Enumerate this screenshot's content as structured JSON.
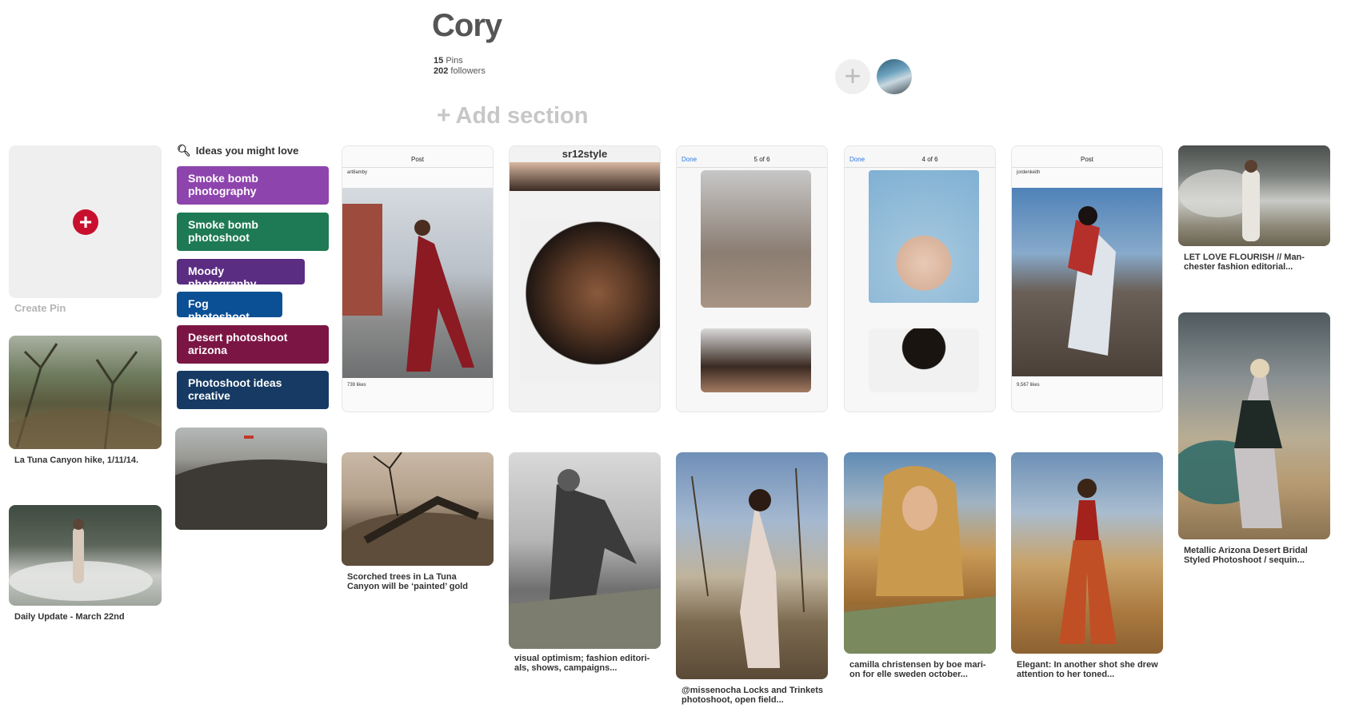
{
  "board": {
    "title": "Cory",
    "pins_count": "15",
    "pins_label": "Pins",
    "followers_count": "202",
    "followers_label": "followers",
    "add_icon": "plus-icon",
    "add_section_label": "Add section"
  },
  "create_pin": {
    "label": "Create Pin"
  },
  "ideas": {
    "header": "Ideas you might love",
    "items": [
      {
        "label": "Smoke bomb photography",
        "color": "#8e44ad"
      },
      {
        "label": "Smoke bomb photoshoot",
        "color": "#1e7a54"
      },
      {
        "label": "Moody photography",
        "color": "#5a2d82"
      },
      {
        "label": "Fog photoshoot",
        "color": "#0b4f94"
      },
      {
        "label": "Desert photoshoot arizona",
        "color": "#7b1544"
      },
      {
        "label": "Photoshoot ideas creative",
        "color": "#163a63"
      }
    ]
  },
  "pins": {
    "la_tuna": "La Tuna Canyon hike, 1/11/14.",
    "daily_update": "Daily Update - March 22nd",
    "scorched": "Scorched trees in La Tuna Canyon will be ‘painted’ gold",
    "visual_optimism": "visual optimism; fashion editori- als, shows, campaigns...",
    "missenocha": "@missenocha Locks and Trinkets photoshoot, open field...",
    "camilla": "camilla christensen by boe mari- on for elle sweden october...",
    "elegant": "Elegant: In another shot she drew attention to her toned...",
    "let_love": "LET LOVE FLOURISH // Man- chester fashion editorial...",
    "metallic": "Metallic Arizona Desert Bridal Styled Photoshoot / sequin...",
    "sr12": "sr12style",
    "phone_post": "Post",
    "phone_done": "Done",
    "phone_5of6": "5 of 6",
    "phone_4of6": "4 of 6",
    "phone_artbamby": "art8amby",
    "phone_jorden": "jordenkeith",
    "phone_likes1": "739 likes",
    "phone_likes2": "9,567 likes"
  }
}
